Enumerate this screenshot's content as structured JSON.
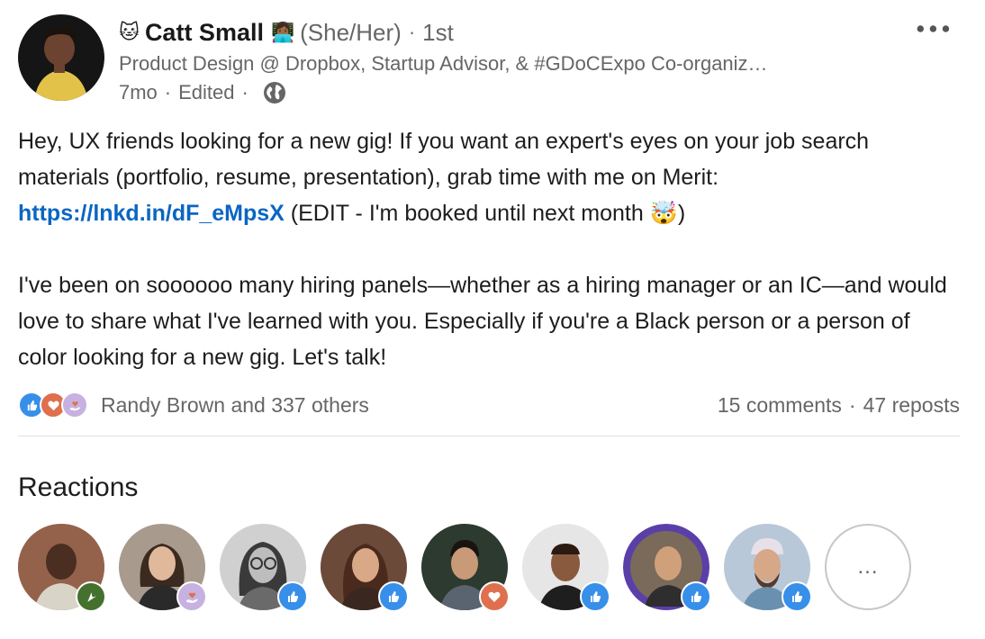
{
  "author": {
    "name": "Catt Small",
    "pronouns": "(She/Her)",
    "degree": "1st",
    "headline": "Product Design @ Dropbox, Startup Advisor, & #GDoCExpo Co-organiz…",
    "time": "7mo",
    "edited": "Edited",
    "name_emoji": "🐱",
    "tech_emoji": "👩🏾‍💻"
  },
  "post": {
    "text_part1": "Hey, UX friends looking for a new gig! If you want an expert's eyes on your job search materials (portfolio, resume, presentation), grab time with me on Merit: ",
    "link": "https://lnkd.in/dF_eMpsX",
    "text_part2": " (EDIT - I'm booked until next month ",
    "text_part2_emoji": "🤯",
    "text_part2_end": ")",
    "paragraph2": "I've been on soooooo many hiring panels—whether as a hiring manager or an IC—and would love to share what I've learned with you. Especially if you're a Black person or a person of color looking for a new gig. Let's talk!"
  },
  "social": {
    "reaction_summary": "Randy Brown and 337 others",
    "comments": "15 comments",
    "reposts": "47 reposts",
    "separator": "·"
  },
  "reactions": {
    "title": "Reactions",
    "more_label": "...",
    "people": [
      {
        "reaction": "celebrate",
        "bg": "#8d5a45"
      },
      {
        "reaction": "support",
        "bg": "#a89a8c"
      },
      {
        "reaction": "like",
        "bg": "#9a9a9a"
      },
      {
        "reaction": "like",
        "bg": "#6b4a3a"
      },
      {
        "reaction": "love",
        "bg": "#2d3a2f"
      },
      {
        "reaction": "like",
        "bg": "#d8d8d8"
      },
      {
        "reaction": "like",
        "bg": "#5b3fa8"
      },
      {
        "reaction": "like",
        "bg": "#b8c8d8"
      }
    ]
  },
  "colors": {
    "link": "#0a66c2",
    "like": "#378fe9",
    "love": "#df704d",
    "support": "#c7b1e0",
    "celebrate": "#44712e",
    "muted_text": "#666666"
  },
  "icons": {
    "more": "ellipsis-horizontal-icon",
    "visibility": "globe-icon"
  }
}
